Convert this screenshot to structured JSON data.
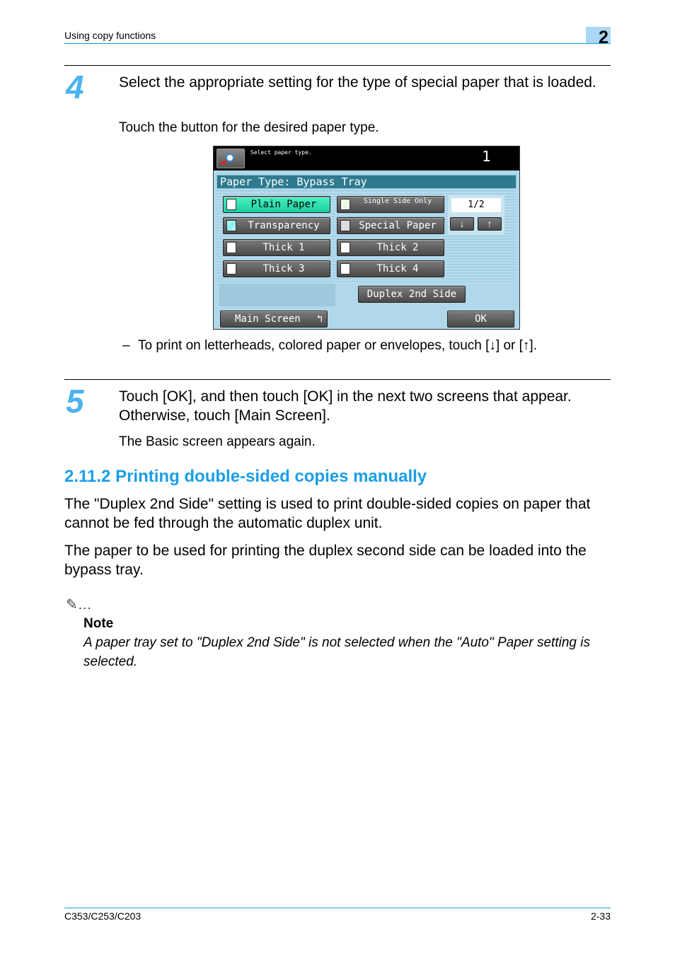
{
  "header": {
    "section_title": "Using copy functions",
    "chapter_number": "2"
  },
  "step4": {
    "number": "4",
    "instruction": "Select the appropriate setting for the type of special paper that is loaded.",
    "detail": "Touch the button for the desired paper type."
  },
  "screen": {
    "message": "Select paper type.",
    "count": "1",
    "title": "Paper Type: Bypass Tray",
    "paper_buttons": [
      {
        "label": "Plain Paper",
        "selected": true
      },
      {
        "label": "Single Side Only",
        "selected": false
      },
      {
        "label": "Transparency",
        "selected": false
      },
      {
        "label": "Special Paper",
        "selected": false
      },
      {
        "label": "Thick 1",
        "selected": false
      },
      {
        "label": "Thick 2",
        "selected": false
      },
      {
        "label": "Thick 3",
        "selected": false
      },
      {
        "label": "Thick 4",
        "selected": false
      }
    ],
    "page_indicator": "1/2",
    "down_arrow": "↓",
    "up_arrow": "↑",
    "duplex_button": "Duplex 2nd Side",
    "main_screen_button": "Main Screen",
    "main_screen_icon": "↰",
    "ok_button": "OK",
    "selected_color": "#2de0b0"
  },
  "step4_bullet": "To print on letterheads, colored paper or envelopes, touch [↓] or [↑].",
  "step5": {
    "number": "5",
    "instruction": "Touch [OK], and then touch [OK] in the next two screens that appear. Otherwise, touch [Main Screen].",
    "detail": "The Basic screen appears again."
  },
  "section": {
    "title": "2.11.2 Printing double-sided copies manually",
    "paragraphs": [
      "The \"Duplex 2nd Side\" setting is used to print double-sided copies on paper that cannot be fed through the automatic duplex unit.",
      "The paper to be used for printing the duplex second side can be loaded into the bypass tray."
    ]
  },
  "note": {
    "icon": "✎…",
    "title": "Note",
    "text": "A paper tray set to \"Duplex 2nd Side\" is not selected when the \"Auto\" Paper setting is selected."
  },
  "footer": {
    "model": "C353/C253/C203",
    "page": "2-33"
  }
}
